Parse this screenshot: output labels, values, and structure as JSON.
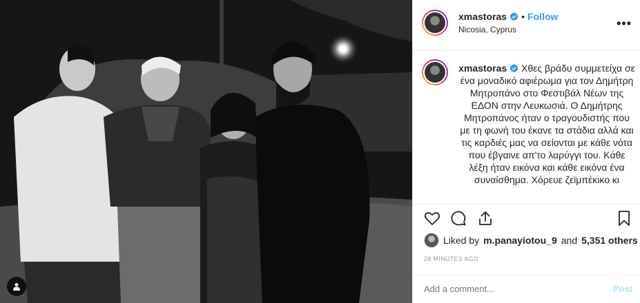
{
  "post": {
    "username": "xmastoras",
    "follow_label": "Follow",
    "separator": "•",
    "location": "Nicosia, Cyprus",
    "more_label": "•••",
    "caption": "Χθες βράδυ συμμετείχα σε ένα μοναδικό αφιέρωμα για τον Δημήτρη Μητροπάνο στο Φεστιβάλ Νέων της ΕΔΟΝ στην Λευκωσιά. Ο Δημήτρης Μητροπάνος ήταν ο τραγουδιστής που με τη φωνή του έκανε τα στάδια αλλά και τις καρδιές μας να σείονται με κάθε νότα που έβγαινε απ'το λαρύγγι του. Κάθε λέξη ήταν εικόνα και κάθε εικόνα ένα συναίσθημα. Χόρευε ζεϊμπέκικο κι",
    "likes_prefix": "Liked by",
    "liked_by_user": "m.panayiotou_9",
    "likes_and": "and",
    "likes_others": "5,351 others",
    "time_ago": "28 MINUTES AGO",
    "comment_placeholder": "Add a comment...",
    "post_label": "Post"
  },
  "icons": {
    "verified": "verified-badge-icon",
    "like": "heart-icon",
    "comment": "comment-bubble-icon",
    "share": "share-icon",
    "save": "bookmark-icon",
    "tags": "user-tag-icon",
    "more": "more-options-icon"
  },
  "colors": {
    "link": "#3897f0",
    "verified": "#3897f0",
    "post_disabled": "#b2dffc",
    "muted": "#999999",
    "text": "#262626",
    "border": "#efefef"
  }
}
